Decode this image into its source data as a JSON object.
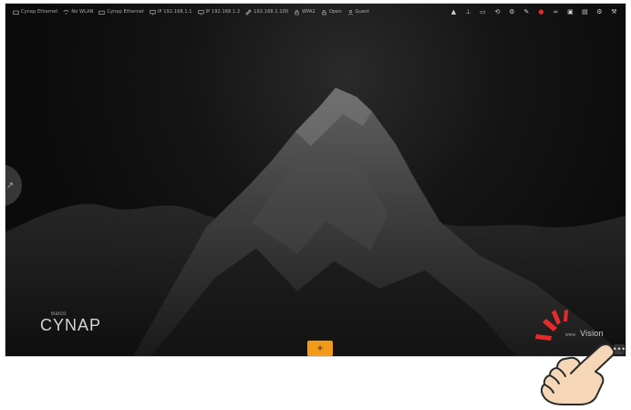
{
  "topbar": {
    "status_items": [
      "Cynap Ethernet",
      "No WLAN",
      "Cynap Ethernet",
      "IP 192.168.1.1",
      "IP 192.168.1.2",
      "192.168.1.100",
      "WPA2",
      "Open",
      "Guest"
    ],
    "tray_icons": [
      "user-icon",
      "network-icon",
      "screen-share-icon",
      "cast-icon",
      "gear-icon",
      "edit-icon",
      "record-icon",
      "link-icon",
      "display-icon",
      "lock-icon",
      "settings-icon",
      "tools-icon"
    ]
  },
  "logo": {
    "brand_top": "Barco",
    "brand_main": "CYNAP"
  },
  "center_button": {
    "label": "+"
  },
  "right_label": {
    "small": "www",
    "text": "Vision"
  },
  "more_button": {
    "label": "•••"
  },
  "colors": {
    "accent_orange": "#f29a1a",
    "annotation_red": "#e52b2b",
    "background_dark": "#0b0b0b"
  }
}
